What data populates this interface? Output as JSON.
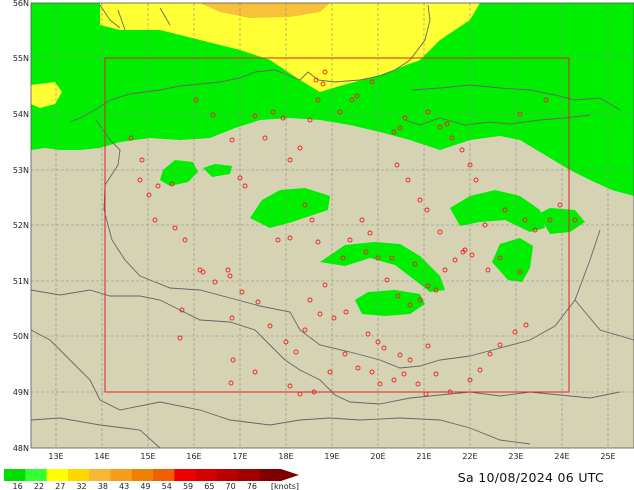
{
  "map": {
    "lat_labels": [
      "48N",
      "49N",
      "50N",
      "51N",
      "52N",
      "53N",
      "54N",
      "55N",
      "56N"
    ],
    "lon_labels": [
      "13E",
      "14E",
      "15E",
      "16E",
      "17E",
      "18E",
      "19E",
      "20E",
      "21E",
      "22E",
      "23E",
      "24E",
      "25E"
    ],
    "colors": {
      "land": "#d6d2b4",
      "wind_16_22": "#00ee00",
      "wind_22_27": "#ffff33",
      "wind_27_32": "#f7c23a",
      "grid": "#8a8a8a",
      "border": "#666666",
      "station": "#ee2222",
      "domain_box": "#e02020"
    }
  },
  "legend": {
    "labels": [
      "16",
      "22",
      "27",
      "32",
      "38",
      "43",
      "49",
      "54",
      "59",
      "65",
      "70",
      "76"
    ],
    "unit": "[knots]",
    "colors": [
      "#00dd00",
      "#33ff33",
      "#ffff00",
      "#ffd700",
      "#f7b733",
      "#f49d1a",
      "#f08000",
      "#f06000",
      "#ee0000",
      "#d40000",
      "#b80000",
      "#a00000",
      "#800000"
    ]
  },
  "timestamp": "Sa 10/08/2024 06 UTC"
}
